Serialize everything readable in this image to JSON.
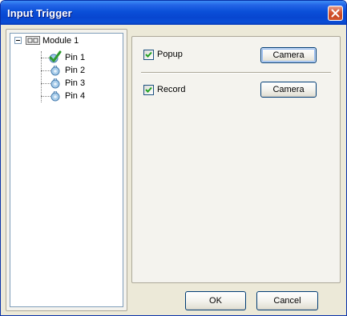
{
  "window": {
    "title": "Input Trigger"
  },
  "tree": {
    "root": {
      "label": "Module 1",
      "icon": "io-module-icon"
    },
    "children": [
      {
        "label": "Pin 1",
        "icon": "pin-active-icon"
      },
      {
        "label": "Pin 2",
        "icon": "pin-icon"
      },
      {
        "label": "Pin 3",
        "icon": "pin-icon"
      },
      {
        "label": "Pin 4",
        "icon": "pin-icon"
      }
    ]
  },
  "options": {
    "popup": {
      "label": "Popup",
      "checked": true,
      "button_label": "Camera"
    },
    "record": {
      "label": "Record",
      "checked": true,
      "button_label": "Camera"
    }
  },
  "footer": {
    "ok_label": "OK",
    "cancel_label": "Cancel"
  },
  "colors": {
    "title_bar": "#0a4fd8",
    "window_face": "#ece9d8",
    "close_button": "#d8603f"
  }
}
